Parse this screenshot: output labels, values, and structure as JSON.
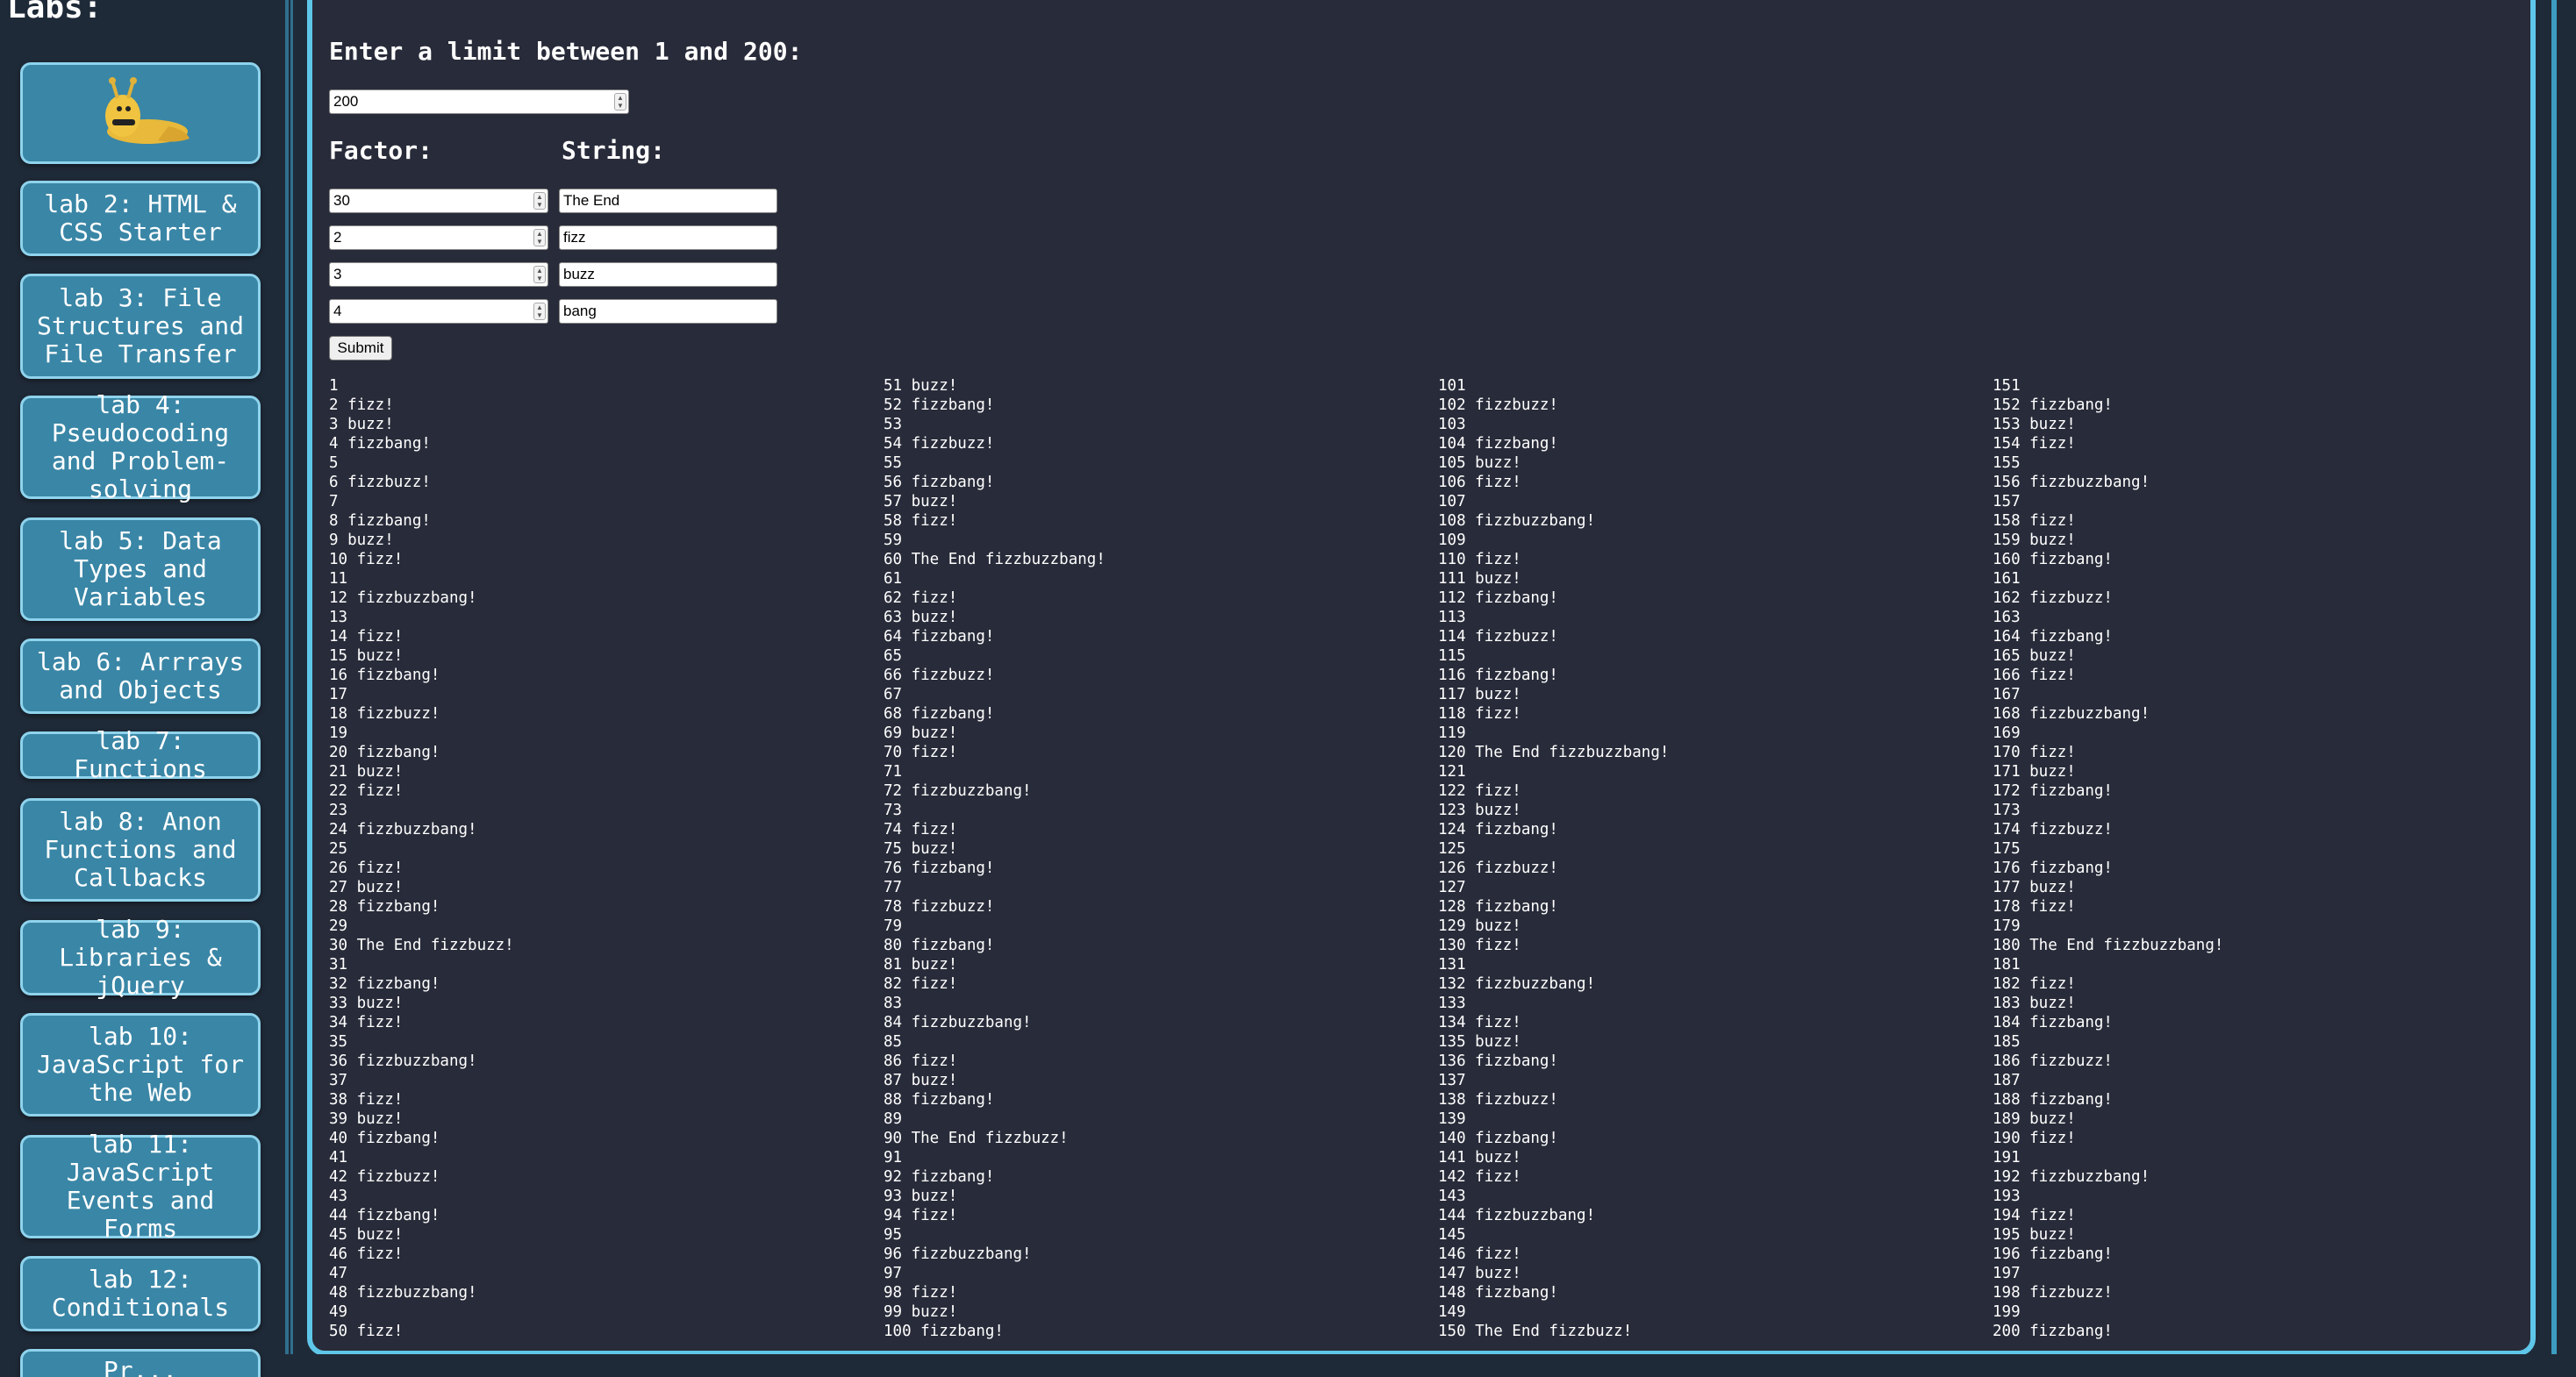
{
  "sidebar": {
    "heading": "Labs:",
    "labs": [
      "lab 2: HTML & CSS Starter",
      "lab 3: File Structures and File Transfer",
      "lab 4: Pseudocoding and Problem-solving",
      "lab 5: Data Types and Variables",
      "lab 6: Arrrays and Objects",
      "lab 7: Functions",
      "lab 8: Anon Functions and Callbacks",
      "lab 9: Libraries & jQuery",
      "lab 10: JavaScript for the Web",
      "lab 11: JavaScript Events and Forms",
      "lab 12: Conditionals"
    ],
    "partial_label": "Pr..."
  },
  "form": {
    "limit_prompt": "Enter a limit between 1 and 200:",
    "limit_value": "200",
    "factor_label": "Factor:",
    "string_label": "String:",
    "rows": [
      {
        "factor": "30",
        "string": "The End"
      },
      {
        "factor": "2",
        "string": "fizz"
      },
      {
        "factor": "3",
        "string": "buzz"
      },
      {
        "factor": "4",
        "string": "bang"
      }
    ],
    "submit_label": "Submit"
  },
  "output_lines": [
    "1",
    "2 fizz!",
    "3 buzz!",
    "4 fizzbang!",
    "5",
    "6 fizzbuzz!",
    "7",
    "8 fizzbang!",
    "9 buzz!",
    "10 fizz!",
    "11",
    "12 fizzbuzzbang!",
    "13",
    "14 fizz!",
    "15 buzz!",
    "16 fizzbang!",
    "17",
    "18 fizzbuzz!",
    "19",
    "20 fizzbang!",
    "21 buzz!",
    "22 fizz!",
    "23",
    "24 fizzbuzzbang!",
    "25",
    "26 fizz!",
    "27 buzz!",
    "28 fizzbang!",
    "29",
    "30 The End fizzbuzz!",
    "31",
    "32 fizzbang!",
    "33 buzz!",
    "34 fizz!",
    "35",
    "36 fizzbuzzbang!",
    "37",
    "38 fizz!",
    "39 buzz!",
    "40 fizzbang!",
    "41",
    "42 fizzbuzz!",
    "43",
    "44 fizzbang!",
    "45 buzz!",
    "46 fizz!",
    "47",
    "48 fizzbuzzbang!",
    "49",
    "50 fizz!",
    "51 buzz!",
    "52 fizzbang!",
    "53",
    "54 fizzbuzz!",
    "55",
    "56 fizzbang!",
    "57 buzz!",
    "58 fizz!",
    "59",
    "60 The End fizzbuzzbang!",
    "61",
    "62 fizz!",
    "63 buzz!",
    "64 fizzbang!",
    "65",
    "66 fizzbuzz!",
    "67",
    "68 fizzbang!",
    "69 buzz!",
    "70 fizz!",
    "71",
    "72 fizzbuzzbang!",
    "73",
    "74 fizz!",
    "75 buzz!",
    "76 fizzbang!",
    "77",
    "78 fizzbuzz!",
    "79",
    "80 fizzbang!",
    "81 buzz!",
    "82 fizz!",
    "83",
    "84 fizzbuzzbang!",
    "85",
    "86 fizz!",
    "87 buzz!",
    "88 fizzbang!",
    "89",
    "90 The End fizzbuzz!",
    "91",
    "92 fizzbang!",
    "93 buzz!",
    "94 fizz!",
    "95",
    "96 fizzbuzzbang!",
    "97",
    "98 fizz!",
    "99 buzz!",
    "100 fizzbang!",
    "101",
    "102 fizzbuzz!",
    "103",
    "104 fizzbang!",
    "105 buzz!",
    "106 fizz!",
    "107",
    "108 fizzbuzzbang!",
    "109",
    "110 fizz!",
    "111 buzz!",
    "112 fizzbang!",
    "113",
    "114 fizzbuzz!",
    "115",
    "116 fizzbang!",
    "117 buzz!",
    "118 fizz!",
    "119",
    "120 The End fizzbuzzbang!",
    "121",
    "122 fizz!",
    "123 buzz!",
    "124 fizzbang!",
    "125",
    "126 fizzbuzz!",
    "127",
    "128 fizzbang!",
    "129 buzz!",
    "130 fizz!",
    "131",
    "132 fizzbuzzbang!",
    "133",
    "134 fizz!",
    "135 buzz!",
    "136 fizzbang!",
    "137",
    "138 fizzbuzz!",
    "139",
    "140 fizzbang!",
    "141 buzz!",
    "142 fizz!",
    "143",
    "144 fizzbuzzbang!",
    "145",
    "146 fizz!",
    "147 buzz!",
    "148 fizzbang!",
    "149",
    "150 The End fizzbuzz!",
    "151",
    "152 fizzbang!",
    "153 buzz!",
    "154 fizz!",
    "155",
    "156 fizzbuzzbang!",
    "157",
    "158 fizz!",
    "159 buzz!",
    "160 fizzbang!",
    "161",
    "162 fizzbuzz!",
    "163",
    "164 fizzbang!",
    "165 buzz!",
    "166 fizz!",
    "167",
    "168 fizzbuzzbang!",
    "169",
    "170 fizz!",
    "171 buzz!",
    "172 fizzbang!",
    "173",
    "174 fizzbuzz!",
    "175",
    "176 fizzbang!",
    "177 buzz!",
    "178 fizz!",
    "179",
    "180 The End fizzbuzzbang!",
    "181",
    "182 fizz!",
    "183 buzz!",
    "184 fizzbang!",
    "185",
    "186 fizzbuzz!",
    "187",
    "188 fizzbang!",
    "189 buzz!",
    "190 fizz!",
    "191",
    "192 fizzbuzzbang!",
    "193",
    "194 fizz!",
    "195 buzz!",
    "196 fizzbang!",
    "197",
    "198 fizzbuzz!",
    "199",
    "200 fizzbang!"
  ]
}
